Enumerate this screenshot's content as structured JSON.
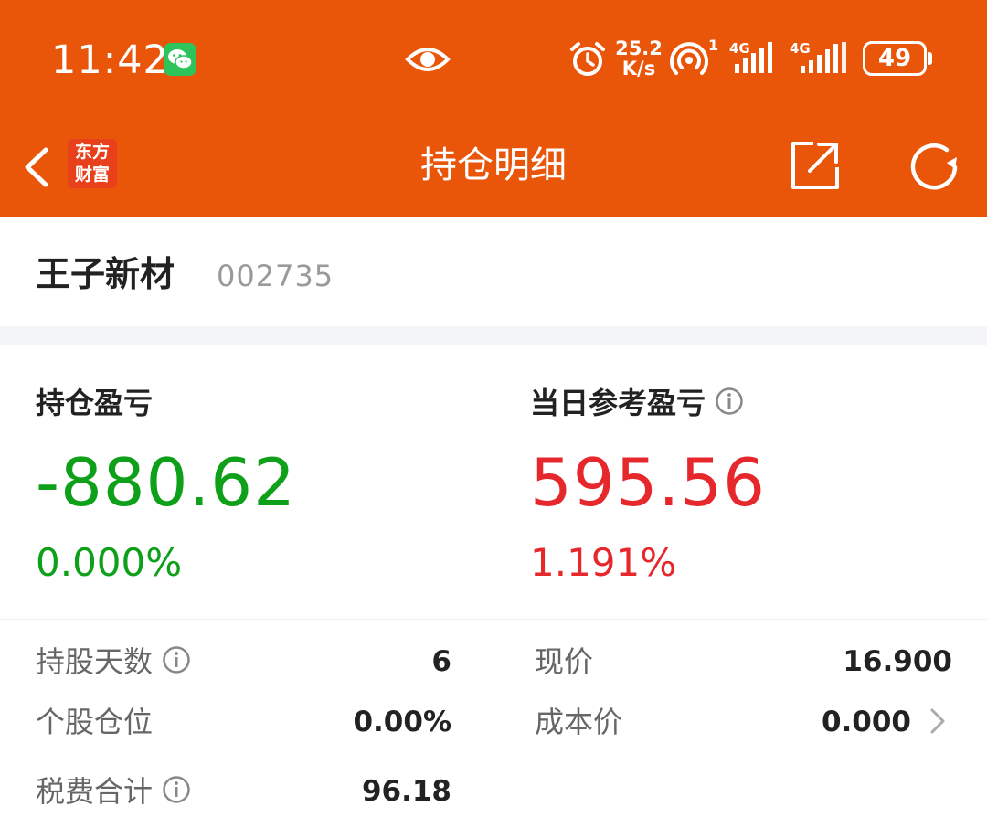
{
  "status_bar": {
    "time": "11:42",
    "net_speed_value": "25.2",
    "net_speed_unit": "K/s",
    "hotspot_count": "1",
    "signal1_label": "4G",
    "signal2_label": "4G",
    "battery": "49",
    "icons": [
      "wechat-icon",
      "eye-icon",
      "alarm-icon",
      "hotspot-icon",
      "signal-icon",
      "battery-icon"
    ]
  },
  "nav": {
    "logo_line1": "东方",
    "logo_line2": "财富",
    "title": "持仓明细",
    "icons": [
      "back-icon",
      "share-icon",
      "refresh-icon"
    ]
  },
  "stock": {
    "name": "王子新材",
    "code": "002735"
  },
  "pnl": {
    "position_label": "持仓盈亏",
    "position_value": "-880.62",
    "position_pct": "0.000%",
    "daily_label": "当日参考盈亏",
    "daily_value": "595.56",
    "daily_pct": "1.191%"
  },
  "details": {
    "hold_days_label": "持股天数",
    "hold_days_value": "6",
    "current_price_label": "现价",
    "current_price_value": "16.900",
    "position_ratio_label": "个股仓位",
    "position_ratio_value": "0.00%",
    "cost_price_label": "成本价",
    "cost_price_value": "0.000",
    "fees_label": "税费合计",
    "fees_value": "96.18"
  },
  "colors": {
    "brand_orange": "#e9560a",
    "gain_red": "#e6282d",
    "loss_green": "#0fa01a"
  }
}
